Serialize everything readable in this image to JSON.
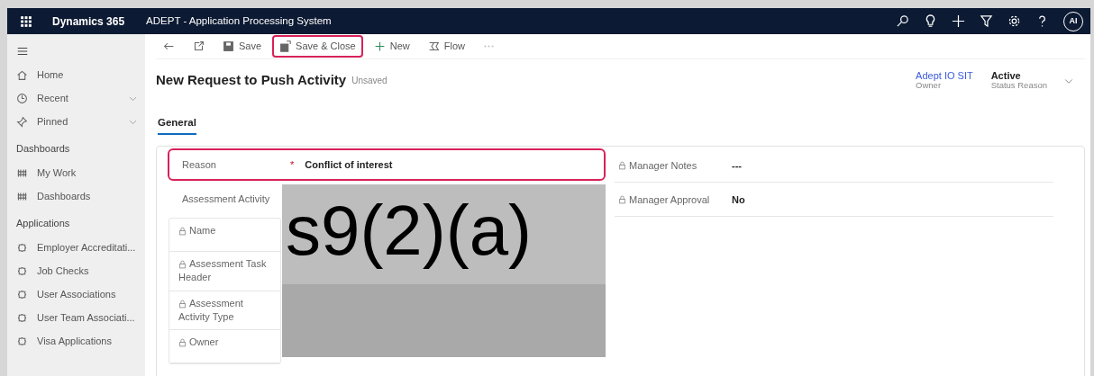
{
  "app": {
    "product": "Dynamics 365",
    "title": "ADEPT - Application Processing System",
    "avatar": "AI"
  },
  "sidebar": [
    {
      "kind": "home",
      "label": "Home",
      "expandable": false
    },
    {
      "kind": "recent",
      "label": "Recent",
      "expandable": true
    },
    {
      "kind": "pinned",
      "label": "Pinned",
      "expandable": true
    },
    {
      "kind": "heading",
      "label": "Dashboards"
    },
    {
      "kind": "dashboard",
      "label": "My Work",
      "expandable": false
    },
    {
      "kind": "dashboard",
      "label": "Dashboards",
      "expandable": false
    },
    {
      "kind": "heading",
      "label": "Applications"
    },
    {
      "kind": "entity",
      "label": "Employer Accreditati...",
      "expandable": false
    },
    {
      "kind": "entity",
      "label": "Job Checks",
      "expandable": false
    },
    {
      "kind": "entity",
      "label": "User Associations",
      "expandable": false
    },
    {
      "kind": "entity",
      "label": "User Team Associati...",
      "expandable": false
    },
    {
      "kind": "entity",
      "label": "Visa Applications",
      "expandable": false
    }
  ],
  "toolbar": [
    {
      "kind": "back",
      "highlighted": false
    },
    {
      "kind": "popout",
      "highlighted": false
    },
    {
      "kind": "save",
      "label": "Save",
      "highlighted": false
    },
    {
      "kind": "save-close",
      "label": "Save & Close",
      "highlighted": true
    },
    {
      "kind": "new",
      "label": "New",
      "highlighted": false
    },
    {
      "kind": "flow",
      "label": "Flow",
      "highlighted": false
    },
    {
      "kind": "more",
      "highlighted": false
    }
  ],
  "record": {
    "title": "New Request to Push Activity",
    "state": "Unsaved",
    "owner": {
      "value": "Adept IO SIT",
      "label": "Owner"
    },
    "status": {
      "value": "Active",
      "label": "Status Reason"
    }
  },
  "tabs": [
    {
      "label": "General",
      "selected": true
    }
  ],
  "reason": {
    "label": "Reason",
    "required_mark": "*",
    "value": "Conflict of interest",
    "highlighted": true
  },
  "section_label": "Assessment Activity",
  "subfields": [
    {
      "label": "Name",
      "locked": true
    },
    {
      "label": "Assessment Task Header",
      "locked": true
    },
    {
      "label": "Assessment Activity Type",
      "locked": true
    },
    {
      "label": "Owner",
      "locked": true
    }
  ],
  "redaction": {
    "text": "s9(2)(a)"
  },
  "right_fields": [
    {
      "label": "Manager Notes",
      "value": "---",
      "locked": true
    },
    {
      "label": "Manager Approval",
      "value": "No",
      "locked": true
    }
  ]
}
